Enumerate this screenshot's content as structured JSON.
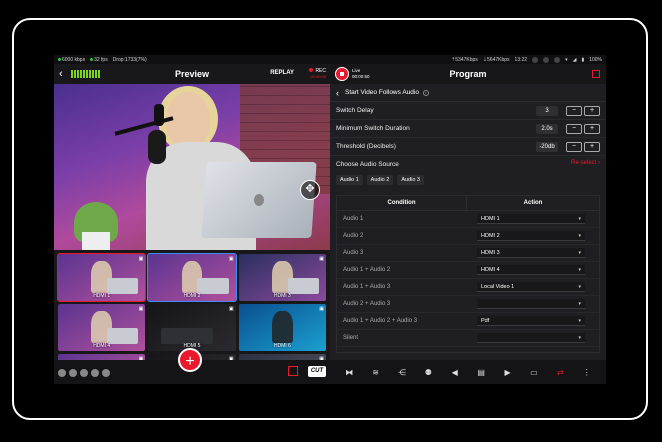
{
  "status": {
    "bitrate": "6000 kbps",
    "fps": "32 fps",
    "drop": "Drop:1733(7%)",
    "upload": "5347Kbps",
    "download": "5647Kbps",
    "clock": "13:22",
    "battery": "100%"
  },
  "preview": {
    "title": "Preview",
    "replay": "REPLAY",
    "rec": "REC",
    "rec_time": "00:00:00"
  },
  "sources": [
    {
      "label": "HDMI 1"
    },
    {
      "label": "HDMI 2"
    },
    {
      "label": "HDMI 3"
    },
    {
      "label": "HDMI 4"
    },
    {
      "label": "HDMI 5"
    },
    {
      "label": "HDMI 6"
    }
  ],
  "bottom_left": {
    "cut": "CUT",
    "plus": "+"
  },
  "program": {
    "title": "Program",
    "live_label": "Live",
    "live_time": "00:00:50"
  },
  "panel": {
    "header": "Start Video Follows Audio",
    "switch_delay_label": "Switch Delay",
    "switch_delay_value": "3",
    "min_duration_label": "Minimum Switch Duration",
    "min_duration_value": "2.0s",
    "threshold_label": "Threshold (Decibels)",
    "threshold_value": "-20db",
    "minus": "−",
    "plus": "+",
    "choose_source_label": "Choose Audio Source",
    "reselect": "Re-select",
    "chips": [
      "Audio 1",
      "Audio 2",
      "Audio 3"
    ]
  },
  "table": {
    "col_condition": "Condition",
    "col_action": "Action",
    "rows": [
      {
        "condition": "Audio 1",
        "action": "HDMI 1"
      },
      {
        "condition": "Audio 2",
        "action": "HDMI 2"
      },
      {
        "condition": "Audio 3",
        "action": "HDMI 3"
      },
      {
        "condition": "Audio 1 + Audio 2",
        "action": "HDMI 4"
      },
      {
        "condition": "Audio 1 + Audio 3",
        "action": "Local Video 1"
      },
      {
        "condition": "Audio 2 + Audio 3",
        "action": ""
      },
      {
        "condition": "Audio 1 + Audio 2 + Audio 3",
        "action": "Pdf"
      },
      {
        "condition": "Silent",
        "action": ""
      }
    ]
  },
  "colors": {
    "accent": "#e8192c",
    "selected_blue": "#3c8cff",
    "panel_bg": "#1f1f23"
  }
}
